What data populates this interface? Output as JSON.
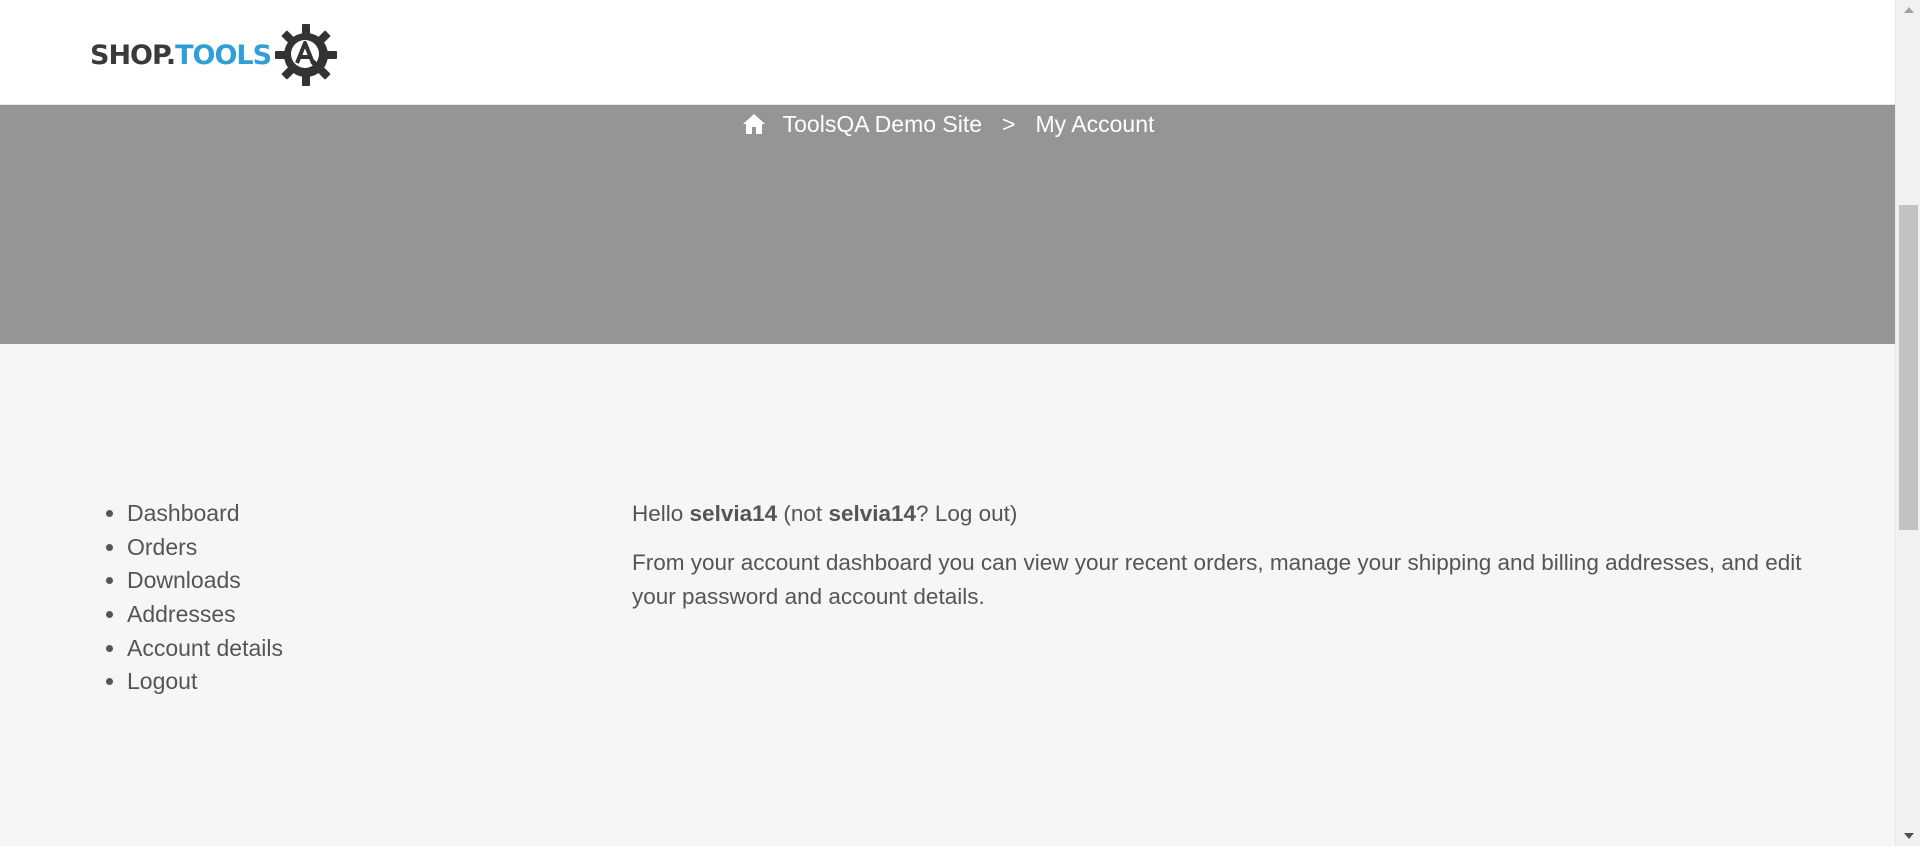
{
  "header": {
    "logo": {
      "part1": "SHOP.",
      "part2": "TOOLS",
      "gear_letter": "A"
    }
  },
  "breadcrumb": {
    "home_icon": "home-icon",
    "home_label": "ToolsQA Demo Site",
    "separator": ">",
    "current": "My Account"
  },
  "account_nav": {
    "items": [
      {
        "label": "Dashboard"
      },
      {
        "label": "Orders"
      },
      {
        "label": "Downloads"
      },
      {
        "label": "Addresses"
      },
      {
        "label": "Account details"
      },
      {
        "label": "Logout"
      }
    ]
  },
  "dashboard": {
    "hello": "Hello",
    "username": "selvia14",
    "not_prefix": "(not",
    "not_username": "selvia14",
    "question": "?",
    "logout_link": "Log out",
    "close_paren": ")",
    "intro_part1": "From your account dashboard you can view your",
    "recent_orders_link": "recent orders",
    "intro_part2": ", manage your",
    "addresses_link": "shipping and billing addresses",
    "intro_part3": ", and",
    "account_details_link": "edit your password and account details",
    "intro_part4": "."
  },
  "colors": {
    "banner": "#959595",
    "logo_dark": "#3a3a3a",
    "logo_blue": "#2f9fd6",
    "text": "#555555",
    "background": "#f6f6f6"
  }
}
